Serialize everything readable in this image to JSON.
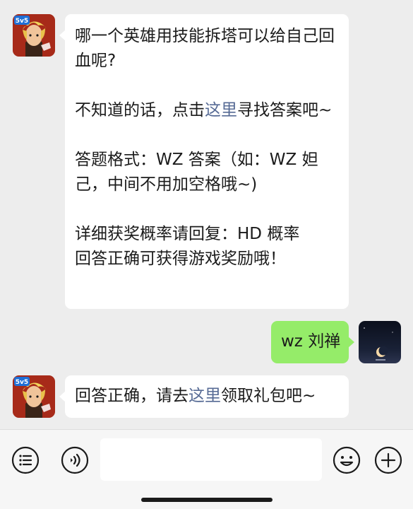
{
  "messages": [
    {
      "from": "bot",
      "avatar_badge": "5v5",
      "paragraphs": [
        {
          "text": "哪一个英雄用技能拆塔可以给自己回血呢?"
        },
        {
          "before": "不知道的话，点击",
          "link": "这里",
          "after": "寻找答案吧~"
        },
        {
          "text": "答题格式：WZ 答案（如：WZ 妲己，中间不用加空格哦~)"
        },
        {
          "text": "详细获奖概率请回复：HD 概率\n回答正确可获得游戏奖励哦！"
        }
      ]
    },
    {
      "from": "user",
      "text": "wz 刘禅"
    },
    {
      "from": "bot",
      "avatar_badge": "5v5",
      "before": "回答正确，请去",
      "link": "这里",
      "after": "领取礼包吧~"
    }
  ],
  "input_bar": {
    "left_icons": [
      "list-menu-icon",
      "voice-icon"
    ],
    "right_icons": [
      "emoji-icon",
      "plus-icon"
    ],
    "input_value": ""
  },
  "colors": {
    "background": "#ededed",
    "bubble_incoming": "#ffffff",
    "bubble_outgoing": "#95ec69",
    "link": "#576b95",
    "input_bar": "#f6f6f6"
  }
}
